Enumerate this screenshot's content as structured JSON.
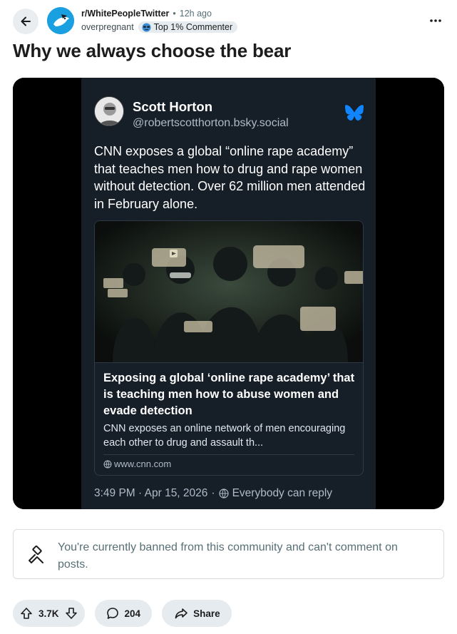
{
  "header": {
    "subreddit": "r/WhitePeopleTwitter",
    "separator": "•",
    "time_ago": "12h ago",
    "username": "overpregnant",
    "flair": "Top 1% Commenter"
  },
  "post": {
    "title": "Why we always choose the bear"
  },
  "embed": {
    "author_name": "Scott Horton",
    "author_handle": "@robertscotthorton.bsky.social",
    "text": "CNN exposes a global “online rape academy” that teaches men how to drug and rape women without detection. Over 62 million men attended in February alone.",
    "link_title": "Exposing a global ‘online rape academy’ that is teaching men how to abuse women and evade detection",
    "link_description": "CNN exposes an online network of men encouraging each other to drug and assault th...",
    "link_domain": "www.cnn.com",
    "timestamp": "3:49 PM · Apr 15, 2026",
    "reply_setting": "Everybody can reply"
  },
  "notice": {
    "banned_text": "You're currently banned from this community and can't comment on posts."
  },
  "actions": {
    "votes": "3.7K",
    "comments": "204",
    "share_label": "Share"
  },
  "colors": {
    "bluesky_blue": "#1185fe",
    "reddit_blue": "#1aa0e0",
    "card_bg": "#161e27"
  }
}
